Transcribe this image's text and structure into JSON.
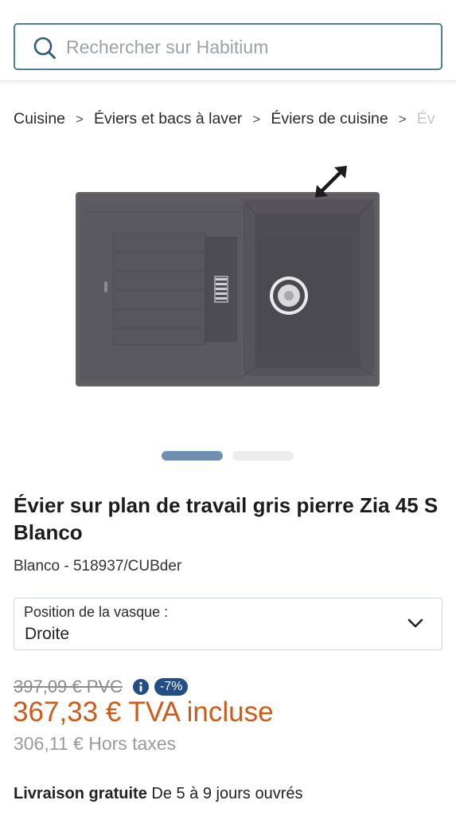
{
  "search": {
    "placeholder": "Rechercher sur Habitium"
  },
  "breadcrumb": {
    "items": [
      "Cuisine",
      "Éviers et bacs à laver",
      "Éviers de cuisine",
      "Év"
    ],
    "separator": ">"
  },
  "gallery": {
    "slide_count": 2,
    "active_slide": 1,
    "active_color": "#6e91b3"
  },
  "product": {
    "title": "Évier sur plan de travail gris pierre Zia 45 S Blanco",
    "brand_ref": "Blanco - 518937/CUBder"
  },
  "option": {
    "label": "Position de la vasque :",
    "value": "Droite"
  },
  "pricing": {
    "old_price": "397,09 € PVC",
    "discount": "-7%",
    "price": "367,33 € TVA incluse",
    "price_ht": "306,11 € Hors taxes",
    "price_color": "#cd5b1a"
  },
  "delivery": {
    "label": "Livraison gratuite",
    "detail": "De 5 à 9 jours ouvrés"
  }
}
